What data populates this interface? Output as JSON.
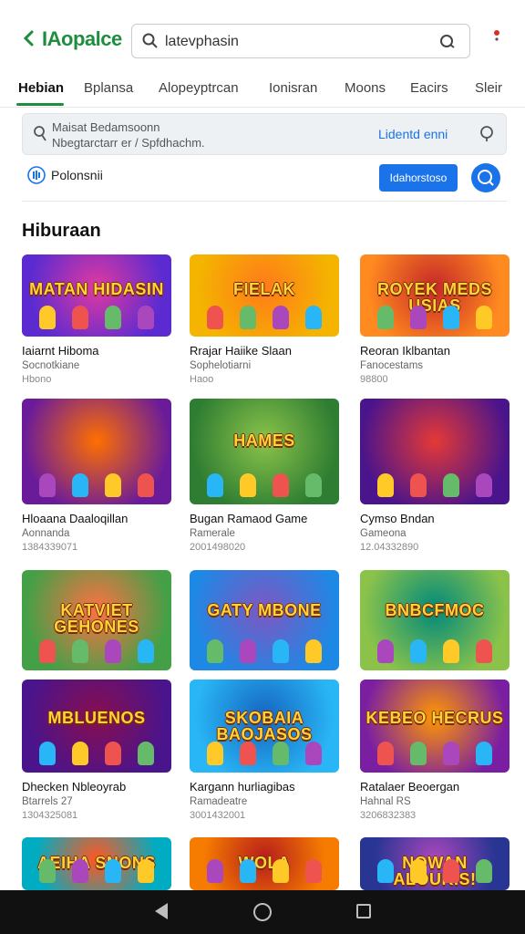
{
  "header": {
    "brand": "IAopalce",
    "search_text": "latevphasin"
  },
  "tabs": [
    {
      "label": "Hebian"
    },
    {
      "label": "Bplansa"
    },
    {
      "label": "Alopeyptrcan"
    },
    {
      "label": "Ionisran"
    },
    {
      "label": "Moons"
    },
    {
      "label": "Eacirs"
    },
    {
      "label": "Sleir"
    }
  ],
  "info": {
    "line1": "Maisat Bedamsoonn",
    "line2": "Nbegtarctarr er / Spfdhachm.",
    "link": "Lidentd enni"
  },
  "filter": {
    "label": "Polonsnii",
    "button": "Idahorstoso"
  },
  "section": {
    "title": "Hiburaan"
  },
  "cards": [
    {
      "thumb_text": "MATAN HIDASIN",
      "title": "Iaiarnt Hiboma",
      "sub": "Socnotkiane",
      "meta": "Hbono",
      "bg": "#5b2bd1",
      "bg2": "#e0399f"
    },
    {
      "thumb_text": "FIELAK",
      "title": "Rrajar Haiike Slaan",
      "sub": "Sophelotiarni",
      "meta": "Haoo",
      "bg": "#f4b400",
      "bg2": "#ff7a1a"
    },
    {
      "thumb_text": "ROYEK MEDS USIAS",
      "title": "Reoran Iklbantan",
      "sub": "Fanocestams",
      "meta": "98800",
      "bg": "#ff8a1f",
      "bg2": "#c62828"
    },
    {
      "thumb_text": "",
      "title": "Hloaana Daaloqillan",
      "sub": "Aonnanda",
      "meta": "1384339071",
      "bg": "#6a1b9a",
      "bg2": "#ff6f00"
    },
    {
      "thumb_text": "HAMES",
      "title": "Bugan Ramaod Game",
      "sub": "Ramerale",
      "meta": "2001498020",
      "bg": "#2e7d32",
      "bg2": "#8bc34a"
    },
    {
      "thumb_text": "",
      "title": "Cymso Bndan",
      "sub": "Gameona",
      "meta": "12.04332890",
      "bg": "#4a148c",
      "bg2": "#e53935"
    },
    {
      "thumb_text": "KATVIET GEHONES",
      "title": "",
      "sub": "",
      "meta": "",
      "bg": "#43a047",
      "bg2": "#ff7043"
    },
    {
      "thumb_text": "GATY MBONE",
      "title": "",
      "sub": "",
      "meta": "",
      "bg": "#1e88e5",
      "bg2": "#7e57c2"
    },
    {
      "thumb_text": "BNBCFMOC",
      "title": "",
      "sub": "",
      "meta": "",
      "bg": "#8bc34a",
      "bg2": "#00897b"
    },
    {
      "thumb_text": "MBLUENOS",
      "title": "Dhecken Nbleoyrab",
      "sub": "Btarrels 27",
      "meta": "1304325081",
      "bg": "#4a148c",
      "bg2": "#880e4f"
    },
    {
      "thumb_text": "SKOBAIA BAOJASOS",
      "title": "Kargann hurliagibas",
      "sub": "Ramadeatre",
      "meta": "3001432001",
      "bg": "#29b6f6",
      "bg2": "#1565c0"
    },
    {
      "thumb_text": "KEBEO HECRUS",
      "title": "Ratalaer Beoergan",
      "sub": "Hahnal RS",
      "meta": "3206832383",
      "bg": "#7b1fa2",
      "bg2": "#ff9800"
    },
    {
      "thumb_text": "AEIHA SNONS",
      "title": "",
      "sub": "",
      "meta": "",
      "bg": "#00acc1",
      "bg2": "#ff5722"
    },
    {
      "thumb_text": "WOLA",
      "title": "",
      "sub": "",
      "meta": "",
      "bg": "#f57c00",
      "bg2": "#b71c1c"
    },
    {
      "thumb_text": "NOWAN ALOUKIS!",
      "title": "",
      "sub": "",
      "meta": "",
      "bg": "#283593",
      "bg2": "#ab47bc"
    }
  ],
  "colors": {
    "accent": "#1e8e3e",
    "link": "#1a73e8"
  }
}
